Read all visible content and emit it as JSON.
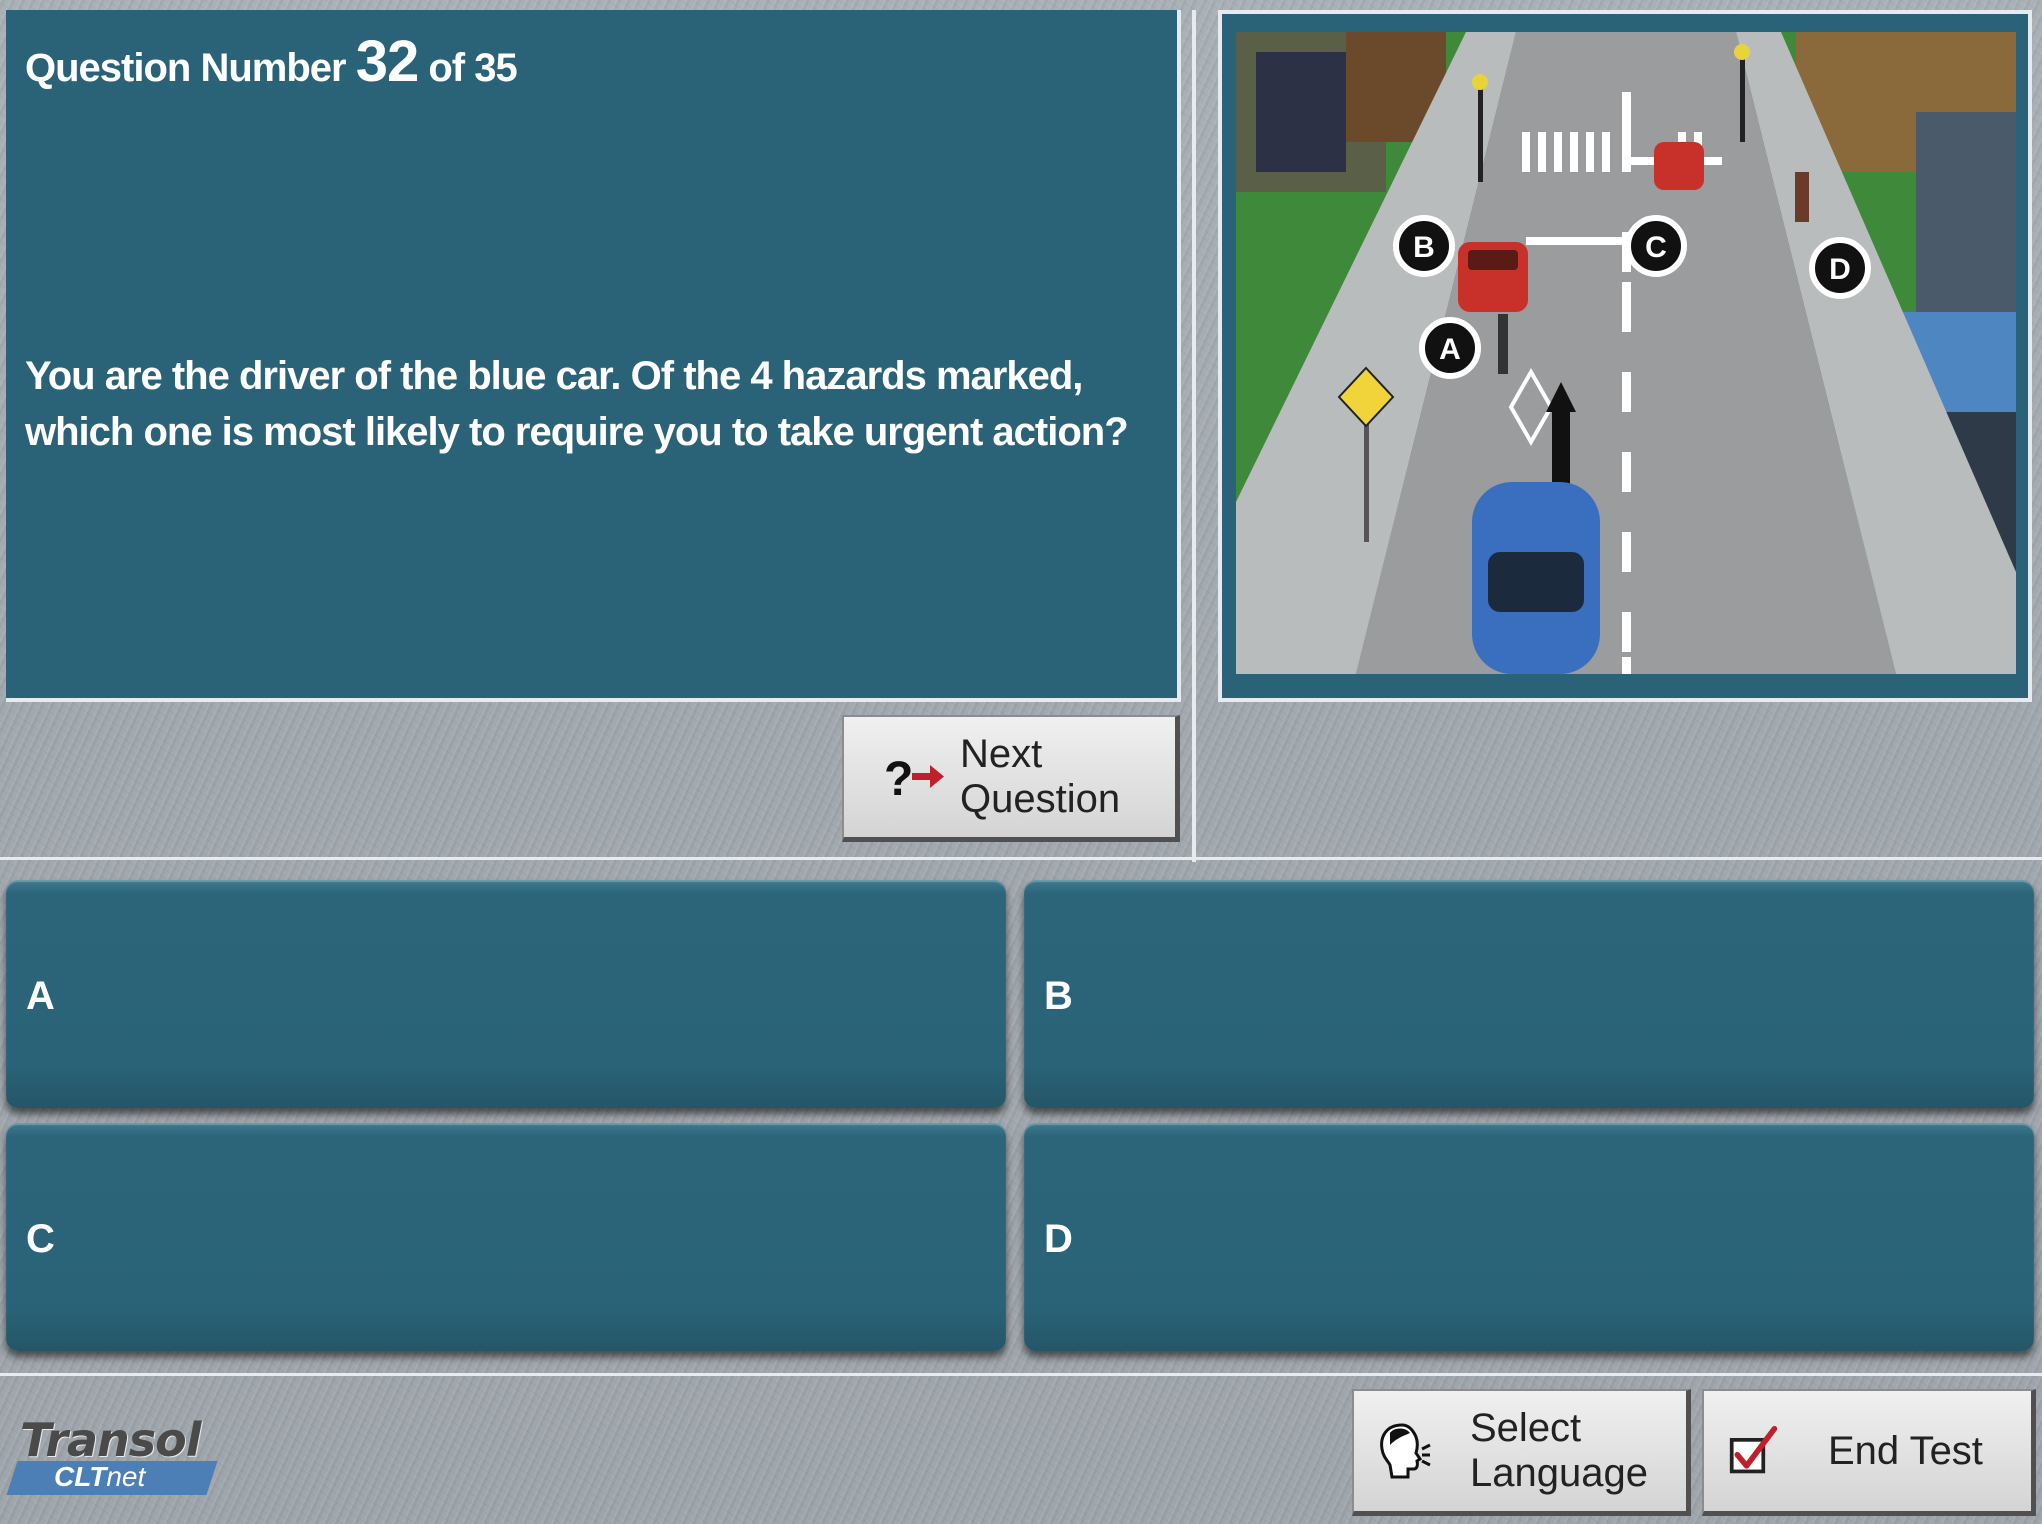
{
  "question": {
    "prefix": "Question Number",
    "number": "32",
    "of_text": "of 35",
    "text": "You are the driver of the blue car. Of the 4 hazards marked, which one is most likely to require you to take urgent action?"
  },
  "image": {
    "markers": [
      "A",
      "B",
      "C",
      "D"
    ]
  },
  "next_button": {
    "line1": "Next",
    "line2": "Question"
  },
  "answers": [
    {
      "letter": "A",
      "text": ""
    },
    {
      "letter": "B",
      "text": ""
    },
    {
      "letter": "C",
      "text": ""
    },
    {
      "letter": "D",
      "text": ""
    }
  ],
  "footer": {
    "logo_main": "Transol",
    "logo_sub_bold": "CLT",
    "logo_sub_rest": "net",
    "language_line1": "Select",
    "language_line2": "Language",
    "end_test": "End Test"
  },
  "colors": {
    "panel": "#2a6378",
    "background": "#a4abb1",
    "accent_red": "#c0202a"
  }
}
